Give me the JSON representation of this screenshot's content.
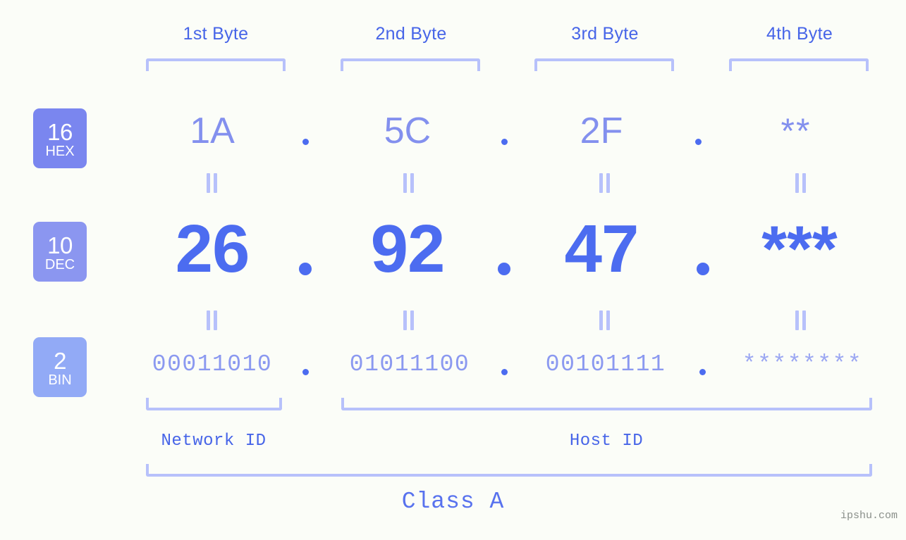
{
  "watermark": "ipshu.com",
  "byte_headers": [
    {
      "label": "1st Byte"
    },
    {
      "label": "2nd Byte"
    },
    {
      "label": "3rd Byte"
    },
    {
      "label": "4th Byte"
    }
  ],
  "rows": [
    {
      "base": "16",
      "base_name": "HEX",
      "values": [
        "1A",
        "5C",
        "2F",
        "**"
      ],
      "separator": "."
    },
    {
      "base": "10",
      "base_name": "DEC",
      "values": [
        "26",
        "92",
        "47",
        "***"
      ],
      "separator": "."
    },
    {
      "base": "2",
      "base_name": "BIN",
      "values": [
        "00011010",
        "01011100",
        "00101111",
        "********"
      ],
      "separator": "."
    }
  ],
  "segments": {
    "network_id": "Network ID",
    "host_id": "Host ID",
    "class": "Class A"
  },
  "colors": {
    "background": "#fbfdf8",
    "badge_hex": "#7a86ef",
    "badge_dec": "#8b96f0",
    "badge_bin": "#92aaf6",
    "header_text": "#4765e8",
    "hex_text": "#8390ee",
    "dec_text": "#4c6cf0",
    "bin_text": "#8b99f0",
    "bracket": "#b7c1fb",
    "watermark_text": "#8a8f8a"
  }
}
